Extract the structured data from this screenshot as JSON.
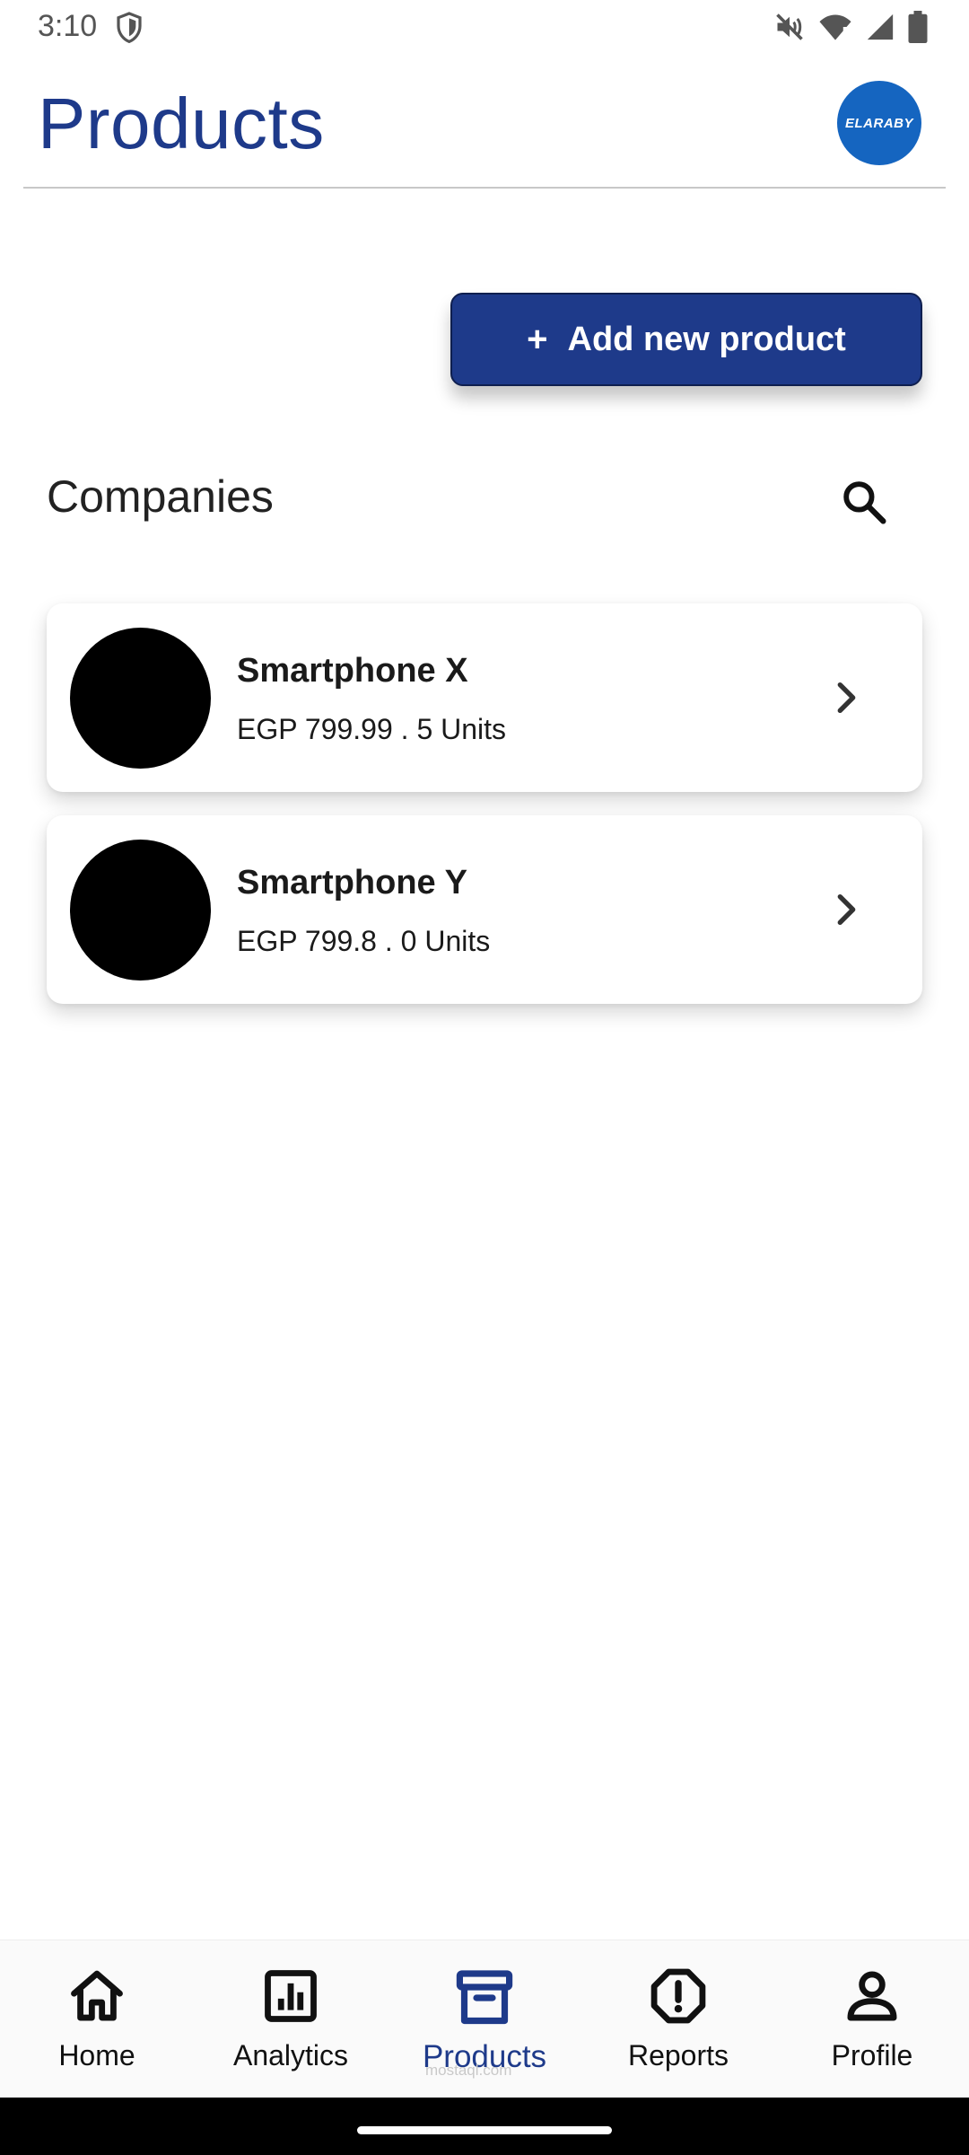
{
  "status_bar": {
    "time": "3:10"
  },
  "header": {
    "title": "Products",
    "logo_text": "ELARABY"
  },
  "actions": {
    "add_plus": "+",
    "add_label": "Add new product"
  },
  "section": {
    "title": "Companies"
  },
  "products": [
    {
      "name": "Smartphone X",
      "meta": "EGP 799.99 . 5 Units"
    },
    {
      "name": "Smartphone Y",
      "meta": "EGP 799.8 . 0 Units"
    }
  ],
  "nav": {
    "items": [
      {
        "label": "Home",
        "icon": "home-icon"
      },
      {
        "label": "Analytics",
        "icon": "analytics-icon"
      },
      {
        "label": "Products",
        "icon": "archive-box-icon",
        "active": true
      },
      {
        "label": "Reports",
        "icon": "alert-octagon-icon"
      },
      {
        "label": "Profile",
        "icon": "person-icon"
      }
    ]
  },
  "watermark": "mostaql.com",
  "colors": {
    "primary": "#1e3a8a",
    "logo_bg": "#1565c0",
    "background": "#ffffff"
  }
}
